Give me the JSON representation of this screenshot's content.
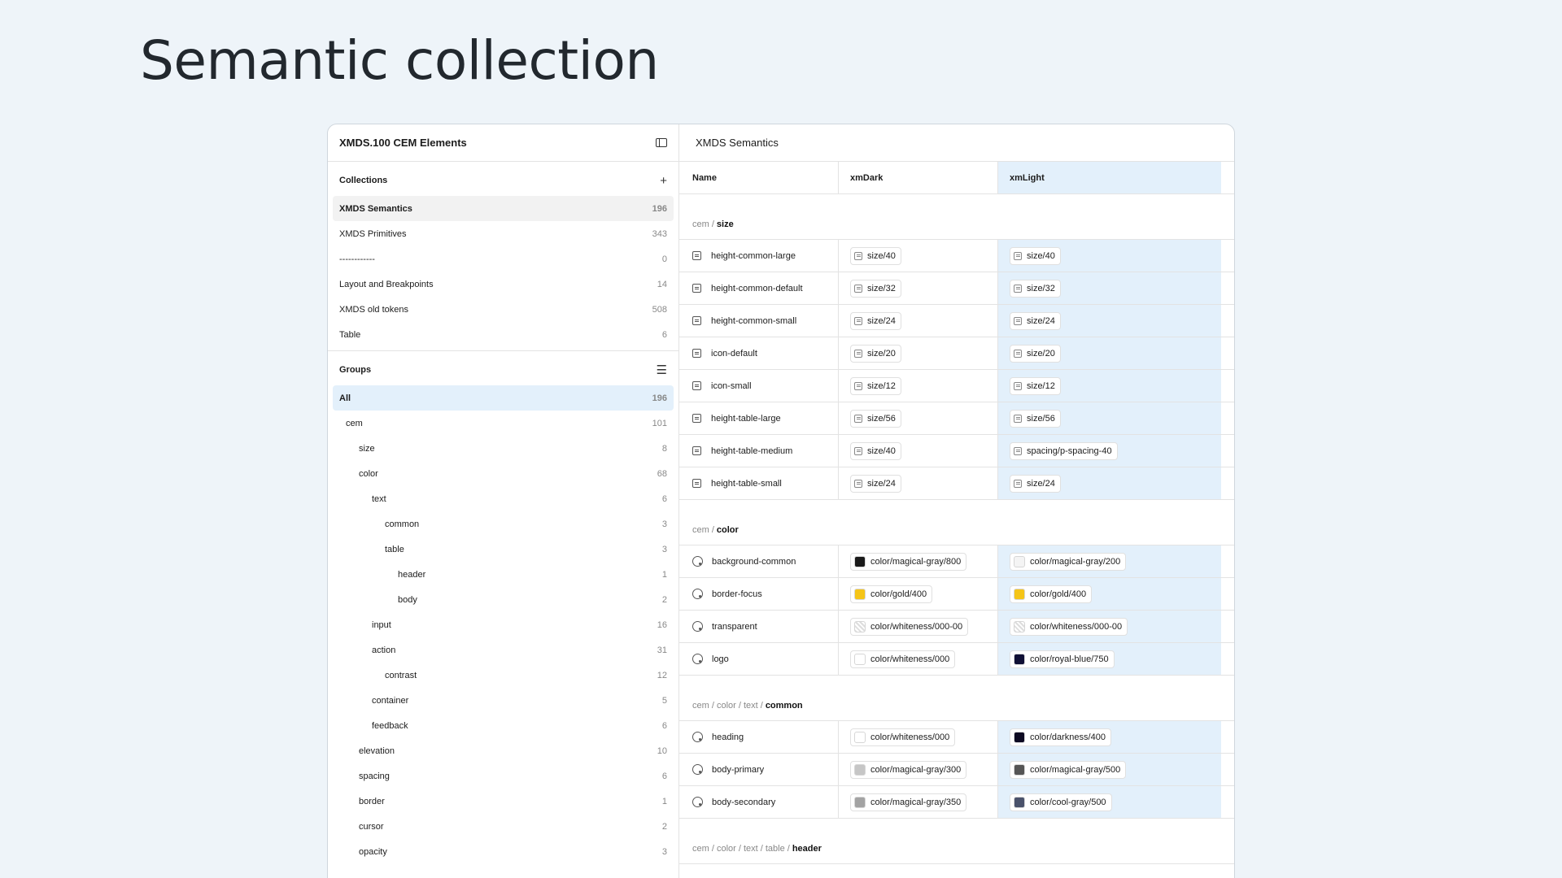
{
  "slide_title": "Semantic collection",
  "left_panel": {
    "title": "XMDS.100 CEM Elements",
    "collections_label": "Collections",
    "collections_action": "+",
    "collections": [
      {
        "label": "XMDS Semantics",
        "count": "196"
      },
      {
        "label": "XMDS Primitives",
        "count": "343"
      },
      {
        "label": "------------",
        "count": "0"
      },
      {
        "label": "Layout and Breakpoints",
        "count": "14"
      },
      {
        "label": "XMDS old tokens",
        "count": "508"
      },
      {
        "label": "Table",
        "count": "6"
      }
    ],
    "groups_label": "Groups",
    "groups_action": "☰",
    "groups": [
      {
        "label": "All",
        "count": "196"
      },
      {
        "label": "cem",
        "count": "101"
      },
      {
        "label": "size",
        "count": "8"
      },
      {
        "label": "color",
        "count": "68"
      },
      {
        "label": "text",
        "count": "6"
      },
      {
        "label": "common",
        "count": "3"
      },
      {
        "label": "table",
        "count": "3"
      },
      {
        "label": "header",
        "count": "1"
      },
      {
        "label": "body",
        "count": "2"
      },
      {
        "label": "input",
        "count": "16"
      },
      {
        "label": "action",
        "count": "31"
      },
      {
        "label": "contrast",
        "count": "12"
      },
      {
        "label": "container",
        "count": "5"
      },
      {
        "label": "feedback",
        "count": "6"
      },
      {
        "label": "elevation",
        "count": "10"
      },
      {
        "label": "spacing",
        "count": "6"
      },
      {
        "label": "border",
        "count": "1"
      },
      {
        "label": "cursor",
        "count": "2"
      },
      {
        "label": "opacity",
        "count": "3"
      }
    ]
  },
  "right_panel": {
    "title": "XMDS Semantics",
    "columns": {
      "name": "Name",
      "dark": "xmDark",
      "light": "xmLight"
    },
    "sections": [
      {
        "path": "cem /",
        "leaf": "size",
        "rows": [
          {
            "name": "height-common-large",
            "dark": "size/40",
            "light": "size/40"
          },
          {
            "name": "height-common-default",
            "dark": "size/32",
            "light": "size/32"
          },
          {
            "name": "height-common-small",
            "dark": "size/24",
            "light": "size/24"
          },
          {
            "name": "icon-default",
            "dark": "size/20",
            "light": "size/20"
          },
          {
            "name": "icon-small",
            "dark": "size/12",
            "light": "size/12"
          },
          {
            "name": "height-table-large",
            "dark": "size/56",
            "light": "size/56"
          },
          {
            "name": "height-table-medium",
            "dark": "size/40",
            "light": "spacing/p-spacing-40"
          },
          {
            "name": "height-table-small",
            "dark": "size/24",
            "light": "size/24"
          }
        ]
      },
      {
        "path": "cem /",
        "leaf": "color",
        "rows": [
          {
            "name": "background-common",
            "dark": "color/magical-gray/800",
            "dark_color": "#1a1a1a",
            "light": "color/magical-gray/200",
            "light_color": "#f4f4f4"
          },
          {
            "name": "border-focus",
            "dark": "color/gold/400",
            "dark_color": "#f5c518",
            "light": "color/gold/400",
            "light_color": "#f5c518"
          },
          {
            "name": "transparent",
            "dark": "color/whiteness/000-00",
            "dark_color": "transparent",
            "light": "color/whiteness/000-00",
            "light_color": "transparent"
          },
          {
            "name": "logo",
            "dark": "color/whiteness/000",
            "dark_color": "#ffffff",
            "light": "color/royal-blue/750",
            "light_color": "#101035"
          }
        ]
      },
      {
        "path": "cem / color / text /",
        "leaf": "common",
        "rows": [
          {
            "name": "heading",
            "dark": "color/whiteness/000",
            "dark_color": "#ffffff",
            "light": "color/darkness/400",
            "light_color": "#0d0a22"
          },
          {
            "name": "body-primary",
            "dark": "color/magical-gray/300",
            "dark_color": "#c6c6c6",
            "light": "color/magical-gray/500",
            "light_color": "#555555"
          },
          {
            "name": "body-secondary",
            "dark": "color/magical-gray/350",
            "dark_color": "#a3a3a3",
            "light": "color/cool-gray/500",
            "light_color": "#4a526b"
          }
        ]
      },
      {
        "path": "cem / color / text / table /",
        "leaf": "header",
        "rows": []
      }
    ]
  }
}
